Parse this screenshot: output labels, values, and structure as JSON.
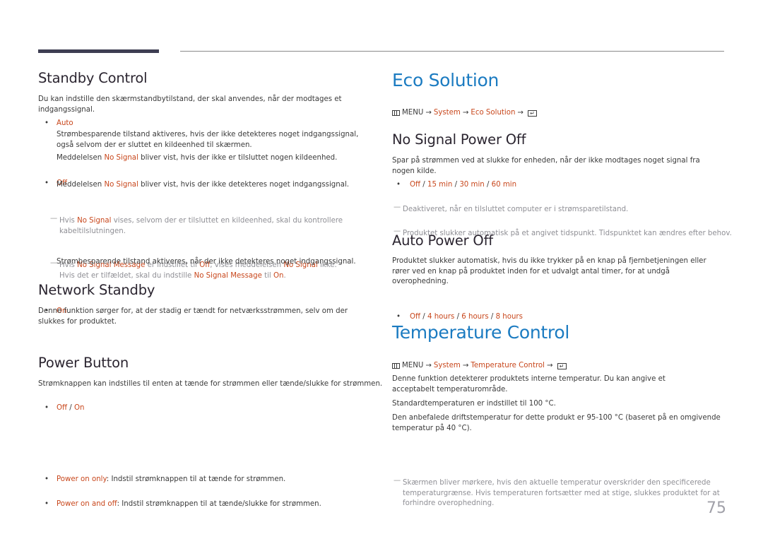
{
  "page_number": "75",
  "colors": {
    "accent_blue": "#1b7bc1",
    "highlight_red": "#c8471c",
    "note_gray": "#8f8f95",
    "top_bar": "#3e3e52"
  },
  "left": {
    "standby_control": {
      "title": "Standby Control",
      "intro": "Du kan indstille den skærmstandbytilstand, der skal anvendes, når der modtages et indgangssignal.",
      "auto": {
        "label": "Auto",
        "desc1": "Strømbesparende tilstand aktiveres, hvis der ikke detekteres noget indgangssignal, også selvom der er sluttet en kildeenhed til skærmen.",
        "desc2_pre": "Meddelelsen ",
        "desc2_red": "No Signal",
        "desc2_post": " bliver vist, hvis der ikke er tilsluttet nogen kildeenhed."
      },
      "off": {
        "label": "Off",
        "desc_pre": "Meddelelsen ",
        "desc_red": "No Signal",
        "desc_post": " bliver vist, hvis der ikke detekteres noget indgangssignal."
      },
      "note1": {
        "pre": "Hvis ",
        "red": "No Signal",
        "post": " vises, selvom der er tilsluttet en kildeenhed, skal du kontrollere kabeltilslutningen."
      },
      "note2": {
        "pre": "Hvis ",
        "red1": "No Signal Message",
        "mid1": " er indstillet til ",
        "red2": "Off",
        "mid2": ", vises meddelelsen ",
        "red3": "No Signal",
        "mid3": " ikke.",
        "line2_pre": "Hvis det er tilfældet, skal du indstille ",
        "red4": "No Signal Message",
        "mid4": " til ",
        "red5": "On",
        "end": "."
      },
      "on": {
        "label": "On",
        "desc": "Strømbesparende tilstand aktiveres, når der ikke detekteres noget indgangssignal."
      }
    },
    "network_standby": {
      "title": "Network Standby",
      "intro": "Denne funktion sørger for, at der stadig er tændt for netværksstrømmen, selv om der slukkes for produktet.",
      "options": [
        "Off",
        "On"
      ]
    },
    "power_button": {
      "title": "Power Button",
      "intro": "Strømknappen kan indstilles til enten at tænde for strømmen eller tænde/slukke for strømmen.",
      "items": [
        {
          "label": "Power on only",
          "desc": ": Indstil strømknappen til at tænde for strømmen."
        },
        {
          "label": "Power on and off",
          "desc": ": Indstil strømknappen til at tænde/slukke for strømmen."
        }
      ]
    }
  },
  "right": {
    "eco_solution": {
      "title": "Eco Solution",
      "menu_path": {
        "menu": "MENU",
        "arrow": "→",
        "steps": [
          "System",
          "Eco Solution"
        ],
        "icon": "enter-icon"
      }
    },
    "no_signal_power_off": {
      "title": "No Signal Power Off",
      "intro": "Spar på strømmen ved at slukke for enheden, når der ikke modtages noget signal fra nogen kilde.",
      "options": [
        "Off",
        "15 min",
        "30 min",
        "60 min"
      ],
      "notes": [
        "Deaktiveret, når en tilsluttet computer er i strømsparetilstand.",
        "Produktet slukker automatisk på et angivet tidspunkt. Tidspunktet kan ændres efter behov."
      ]
    },
    "auto_power_off": {
      "title": "Auto Power Off",
      "intro": "Produktet slukker automatisk, hvis du ikke trykker på en knap på fjernbetjeningen eller rører ved en knap på produktet inden for et udvalgt antal timer, for at undgå overophedning.",
      "options": [
        "Off",
        "4 hours",
        "6 hours",
        "8 hours"
      ]
    },
    "temperature_control": {
      "title": "Temperature Control",
      "menu_path": {
        "menu": "MENU",
        "arrow": "→",
        "steps": [
          "System",
          "Temperature Control"
        ],
        "icon": "enter-icon"
      },
      "p1": "Denne funktion detekterer produktets interne temperatur. Du kan angive et acceptabelt temperaturområde.",
      "p2": "Standardtemperaturen er indstillet til 100 °C.",
      "p3": "Den anbefalede driftstemperatur for dette produkt er 95-100 °C (baseret på en omgivende temperatur på 40 °C).",
      "note": "Skærmen bliver mørkere, hvis den aktuelle temperatur overskrider den specificerede temperaturgrænse. Hvis temperaturen fortsætter med at stige, slukkes produktet for at forhindre overophedning."
    }
  },
  "glyphs": {
    "bullet": "•",
    "dash": "—",
    "slash": " / ",
    "enter": "↵"
  }
}
